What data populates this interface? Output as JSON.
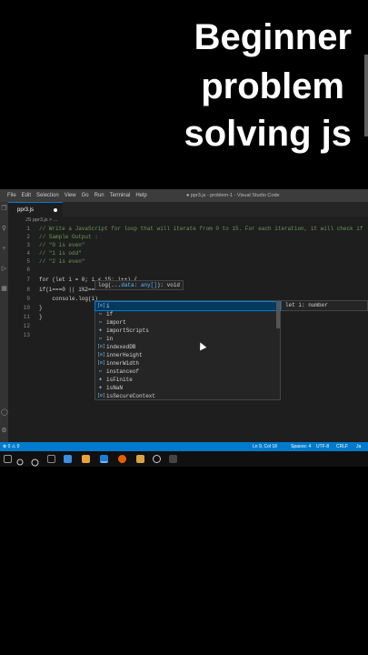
{
  "overlay": {
    "lines": [
      "Beginner",
      "problem",
      "solving js"
    ]
  },
  "window": {
    "title": "● ppr3.js - problem-1 - Visual Studio Code",
    "menu": [
      "File",
      "Edit",
      "Selection",
      "View",
      "Go",
      "Run",
      "Terminal",
      "Help"
    ]
  },
  "tab": {
    "label": "ppr3.js"
  },
  "breadcrumb": "JS ppr3.js > ...",
  "code": [
    {
      "n": "1",
      "text": "// Write a JavaScript for loop that will iterate from 0 to 15. For each iteration, it will check if",
      "cls": "cmt"
    },
    {
      "n": "2",
      "text": "// Sample Output :",
      "cls": "cmt"
    },
    {
      "n": "3",
      "text": "// \"0 is even\"",
      "cls": "cmt"
    },
    {
      "n": "4",
      "text": "// \"1 is odd\"",
      "cls": "cmt"
    },
    {
      "n": "5",
      "text": "// \"2 is even\"",
      "cls": "cmt"
    },
    {
      "n": "6",
      "text": "",
      "cls": "plain"
    },
    {
      "n": "7",
      "text": "for (let i = 0; i < 15; i++) {",
      "cls": "plain"
    },
    {
      "n": "8",
      "text": "if(i===0 || i%2===",
      "cls": "plain"
    },
    {
      "n": "9",
      "text": "    console.log(i)",
      "cls": "plain"
    },
    {
      "n": "10",
      "text": "}",
      "cls": "plain"
    },
    {
      "n": "11",
      "text": "}",
      "cls": "plain"
    },
    {
      "n": "12",
      "text": "",
      "cls": "plain"
    },
    {
      "n": "13",
      "text": "",
      "cls": "plain"
    }
  ],
  "hint": {
    "prefix": "log(...",
    "param": "data: any[]",
    "suffix": "): void"
  },
  "suggestions": [
    "i",
    "if",
    "import",
    "importScripts",
    "in",
    "indexedDB",
    "innerHeight",
    "innerWidth",
    "instanceof",
    "isFinite",
    "isNaN",
    "isSecureContext"
  ],
  "detail": "let i: number",
  "status": {
    "left": "⊗ 0 ⚠ 0",
    "position": "Ln 9, Col 18",
    "spaces": "Spaces: 4",
    "encoding": "UTF-8",
    "eol": "CRLF",
    "lang": "Ja"
  }
}
